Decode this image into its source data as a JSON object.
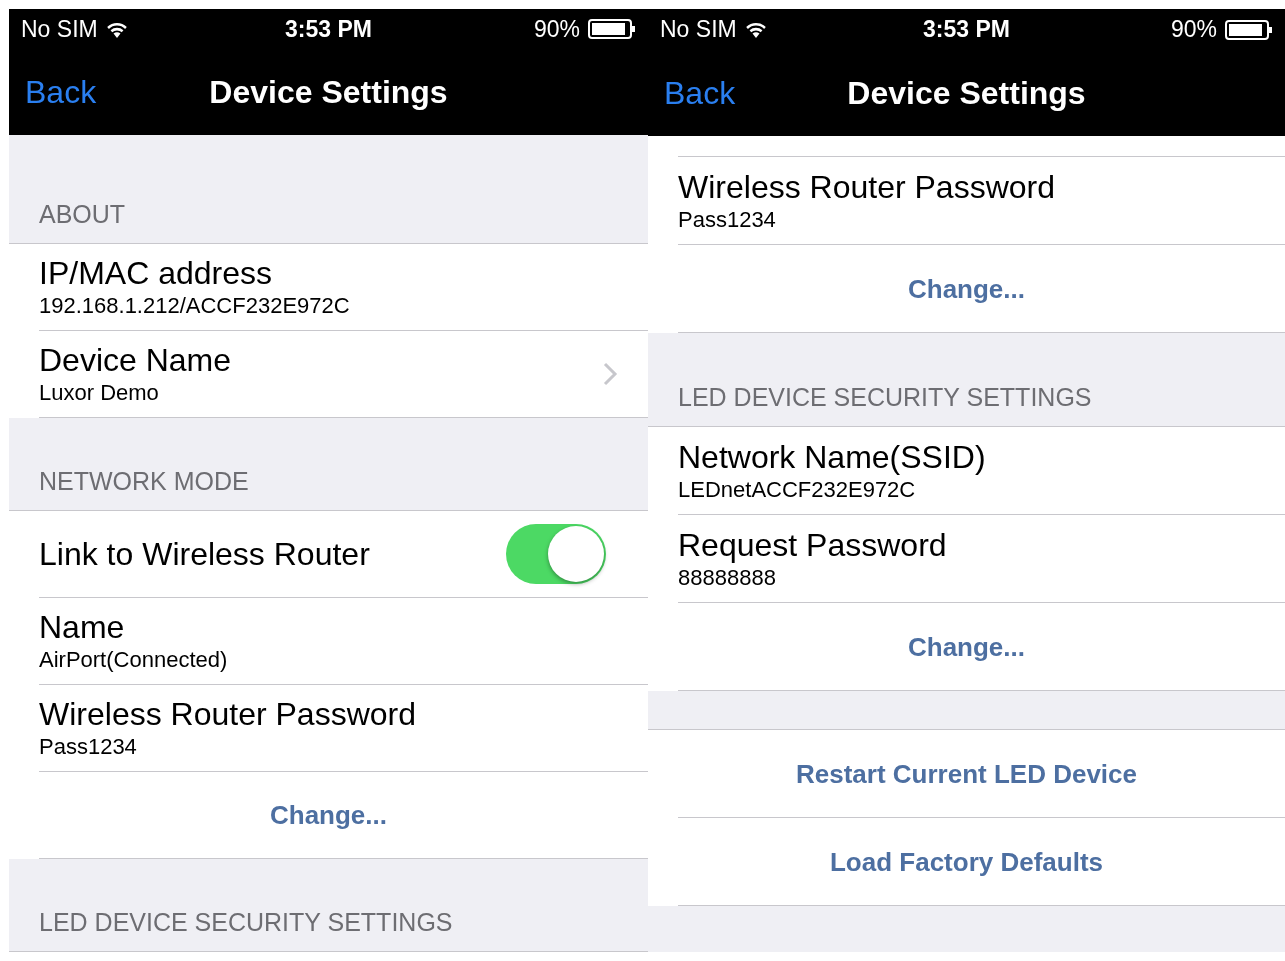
{
  "screens": [
    {
      "status_bar": {
        "carrier": "No SIM",
        "time": "3:53 PM",
        "battery": "90%"
      },
      "nav": {
        "back": "Back",
        "title": "Device Settings"
      },
      "items": [
        {
          "kind": "header",
          "text": "ABOUT"
        },
        {
          "kind": "detail",
          "title": "IP/MAC address",
          "subtitle": "192.168.1.212/ACCF232E972C",
          "disclosure": false
        },
        {
          "kind": "detail",
          "title": "Device Name",
          "subtitle": "Luxor Demo",
          "disclosure": true
        },
        {
          "kind": "header",
          "text": "NETWORK MODE"
        },
        {
          "kind": "toggle",
          "title": "Link to Wireless Router",
          "on": true
        },
        {
          "kind": "detail",
          "title": "Name",
          "subtitle": "AirPort(Connected)",
          "disclosure": false
        },
        {
          "kind": "detail",
          "title": "Wireless Router Password",
          "subtitle": "Pass1234",
          "disclosure": false
        },
        {
          "kind": "action",
          "label": "Change..."
        },
        {
          "kind": "header",
          "text": "LED DEVICE SECURITY SETTINGS"
        }
      ]
    },
    {
      "status_bar": {
        "carrier": "No SIM",
        "time": "3:53 PM",
        "battery": "90%"
      },
      "nav": {
        "back": "Back",
        "title": "Device Settings"
      },
      "items": [
        {
          "kind": "clipped"
        },
        {
          "kind": "detail",
          "title": "Wireless Router Password",
          "subtitle": "Pass1234",
          "disclosure": false
        },
        {
          "kind": "action",
          "label": "Change..."
        },
        {
          "kind": "header",
          "text": "LED DEVICE SECURITY SETTINGS"
        },
        {
          "kind": "detail",
          "title": "Network Name(SSID)",
          "subtitle": "LEDnetACCF232E972C",
          "disclosure": false
        },
        {
          "kind": "detail",
          "title": "Request Password",
          "subtitle": "88888888",
          "disclosure": false
        },
        {
          "kind": "action",
          "label": "Change..."
        },
        {
          "kind": "gap"
        },
        {
          "kind": "action",
          "label": "Restart Current LED Device"
        },
        {
          "kind": "action",
          "label": "Load Factory Defaults"
        }
      ]
    }
  ]
}
